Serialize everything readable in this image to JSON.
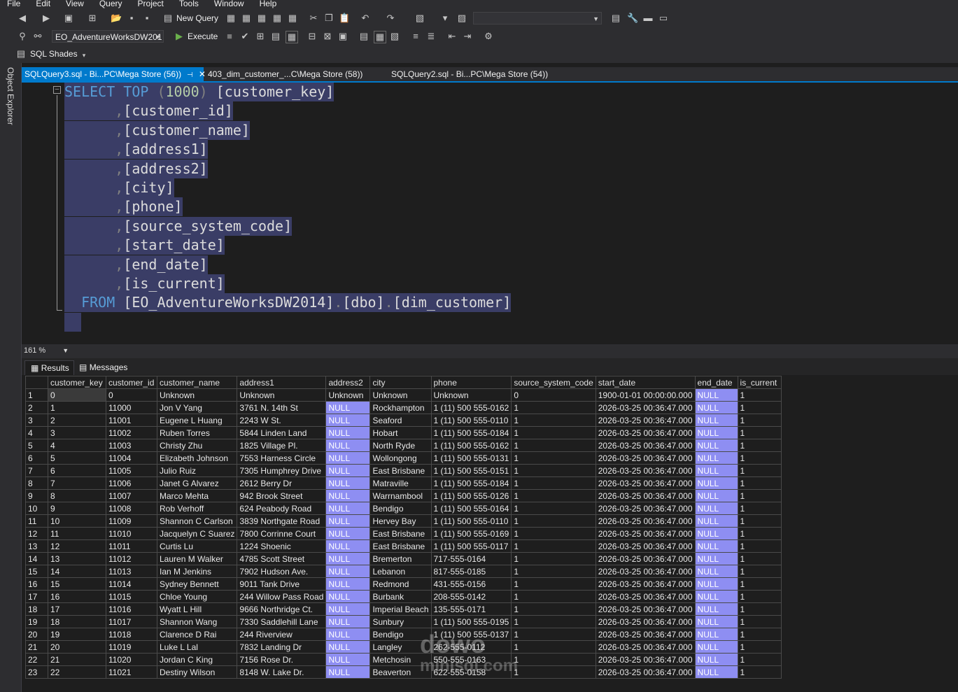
{
  "menu": [
    "File",
    "Edit",
    "View",
    "Query",
    "Project",
    "Tools",
    "Window",
    "Help"
  ],
  "toolbar": {
    "new_query_label": "New Query",
    "database": "EO_AdventureWorksDW201",
    "execute_label": "Execute",
    "sql_shades_label": "SQL Shades"
  },
  "sidebar": {
    "object_explorer": "Object Explorer"
  },
  "tabs": [
    {
      "label": "SQLQuery3.sql - Bi...PC\\Mega Store (56))"
    },
    {
      "label": "403_dim_customer_...C\\Mega Store (58))"
    },
    {
      "label": "SQLQuery2.sql - Bi...PC\\Mega Store (54))"
    }
  ],
  "editor": {
    "zoom": "161 %",
    "lines": [
      {
        "kw": "SELECT TOP ",
        "gr": "(",
        "num": "1000",
        "gr2": ")",
        "txt": " [customer_key]"
      },
      {
        "pre": "      ",
        "gr": ",",
        "txt": "[customer_id]"
      },
      {
        "pre": "      ",
        "gr": ",",
        "txt": "[customer_name]"
      },
      {
        "pre": "      ",
        "gr": ",",
        "txt": "[address1]"
      },
      {
        "pre": "      ",
        "gr": ",",
        "txt": "[address2]"
      },
      {
        "pre": "      ",
        "gr": ",",
        "txt": "[city]"
      },
      {
        "pre": "      ",
        "gr": ",",
        "txt": "[phone]"
      },
      {
        "pre": "      ",
        "gr": ",",
        "txt": "[source_system_code]"
      },
      {
        "pre": "      ",
        "gr": ",",
        "txt": "[start_date]"
      },
      {
        "pre": "      ",
        "gr": ",",
        "txt": "[end_date]"
      },
      {
        "pre": "      ",
        "gr": ",",
        "txt": "[is_current]"
      },
      {
        "pre": "  ",
        "kw": "FROM ",
        "txt": "[EO_AdventureWorksDW2014]",
        "gr": ".",
        "txt2": "[dbo]",
        "gr2": ".",
        "txt3": "[dim_customer]"
      }
    ]
  },
  "results_tabs": {
    "results": "Results",
    "messages": "Messages"
  },
  "grid": {
    "columns": [
      "customer_key",
      "customer_id",
      "customer_name",
      "address1",
      "address2",
      "city",
      "phone",
      "source_system_code",
      "start_date",
      "end_date",
      "is_current"
    ],
    "rows": [
      [
        "1",
        "0",
        "0",
        "Unknown",
        "Unknown",
        "Unknown",
        "Unknown",
        "Unknown",
        "0",
        "1900-01-01 00:00:00.000",
        "NULL",
        "1"
      ],
      [
        "2",
        "1",
        "11000",
        "Jon V Yang",
        "3761 N. 14th St",
        "NULL",
        "Rockhampton",
        "1 (11) 500 555-0162",
        "1",
        "2026-03-25 00:36:47.000",
        "NULL",
        "1"
      ],
      [
        "3",
        "2",
        "11001",
        "Eugene L Huang",
        "2243 W St.",
        "NULL",
        "Seaford",
        "1 (11) 500 555-0110",
        "1",
        "2026-03-25 00:36:47.000",
        "NULL",
        "1"
      ],
      [
        "4",
        "3",
        "11002",
        "Ruben  Torres",
        "5844 Linden Land",
        "NULL",
        "Hobart",
        "1 (11) 500 555-0184",
        "1",
        "2026-03-25 00:36:47.000",
        "NULL",
        "1"
      ],
      [
        "5",
        "4",
        "11003",
        "Christy  Zhu",
        "1825 Village Pl.",
        "NULL",
        "North Ryde",
        "1 (11) 500 555-0162",
        "1",
        "2026-03-25 00:36:47.000",
        "NULL",
        "1"
      ],
      [
        "6",
        "5",
        "11004",
        "Elizabeth  Johnson",
        "7553 Harness Circle",
        "NULL",
        "Wollongong",
        "1 (11) 500 555-0131",
        "1",
        "2026-03-25 00:36:47.000",
        "NULL",
        "1"
      ],
      [
        "7",
        "6",
        "11005",
        "Julio  Ruiz",
        "7305 Humphrey Drive",
        "NULL",
        "East Brisbane",
        "1 (11) 500 555-0151",
        "1",
        "2026-03-25 00:36:47.000",
        "NULL",
        "1"
      ],
      [
        "8",
        "7",
        "11006",
        "Janet G Alvarez",
        "2612 Berry Dr",
        "NULL",
        "Matraville",
        "1 (11) 500 555-0184",
        "1",
        "2026-03-25 00:36:47.000",
        "NULL",
        "1"
      ],
      [
        "9",
        "8",
        "11007",
        "Marco  Mehta",
        "942 Brook Street",
        "NULL",
        "Warrnambool",
        "1 (11) 500 555-0126",
        "1",
        "2026-03-25 00:36:47.000",
        "NULL",
        "1"
      ],
      [
        "10",
        "9",
        "11008",
        "Rob  Verhoff",
        "624 Peabody Road",
        "NULL",
        "Bendigo",
        "1 (11) 500 555-0164",
        "1",
        "2026-03-25 00:36:47.000",
        "NULL",
        "1"
      ],
      [
        "11",
        "10",
        "11009",
        "Shannon C Carlson",
        "3839 Northgate Road",
        "NULL",
        "Hervey Bay",
        "1 (11) 500 555-0110",
        "1",
        "2026-03-25 00:36:47.000",
        "NULL",
        "1"
      ],
      [
        "12",
        "11",
        "11010",
        "Jacquelyn C Suarez",
        "7800 Corrinne Court",
        "NULL",
        "East Brisbane",
        "1 (11) 500 555-0169",
        "1",
        "2026-03-25 00:36:47.000",
        "NULL",
        "1"
      ],
      [
        "13",
        "12",
        "11011",
        "Curtis  Lu",
        "1224 Shoenic",
        "NULL",
        "East Brisbane",
        "1 (11) 500 555-0117",
        "1",
        "2026-03-25 00:36:47.000",
        "NULL",
        "1"
      ],
      [
        "14",
        "13",
        "11012",
        "Lauren M Walker",
        "4785 Scott Street",
        "NULL",
        "Bremerton",
        "717-555-0164",
        "1",
        "2026-03-25 00:36:47.000",
        "NULL",
        "1"
      ],
      [
        "15",
        "14",
        "11013",
        "Ian M Jenkins",
        "7902 Hudson Ave.",
        "NULL",
        "Lebanon",
        "817-555-0185",
        "1",
        "2026-03-25 00:36:47.000",
        "NULL",
        "1"
      ],
      [
        "16",
        "15",
        "11014",
        "Sydney  Bennett",
        "9011 Tank Drive",
        "NULL",
        "Redmond",
        "431-555-0156",
        "1",
        "2026-03-25 00:36:47.000",
        "NULL",
        "1"
      ],
      [
        "17",
        "16",
        "11015",
        "Chloe  Young",
        "244 Willow Pass Road",
        "NULL",
        "Burbank",
        "208-555-0142",
        "1",
        "2026-03-25 00:36:47.000",
        "NULL",
        "1"
      ],
      [
        "18",
        "17",
        "11016",
        "Wyatt L Hill",
        "9666 Northridge Ct.",
        "NULL",
        "Imperial Beach",
        "135-555-0171",
        "1",
        "2026-03-25 00:36:47.000",
        "NULL",
        "1"
      ],
      [
        "19",
        "18",
        "11017",
        "Shannon  Wang",
        "7330 Saddlehill Lane",
        "NULL",
        "Sunbury",
        "1 (11) 500 555-0195",
        "1",
        "2026-03-25 00:36:47.000",
        "NULL",
        "1"
      ],
      [
        "20",
        "19",
        "11018",
        "Clarence D Rai",
        "244 Riverview",
        "NULL",
        "Bendigo",
        "1 (11) 500 555-0137",
        "1",
        "2026-03-25 00:36:47.000",
        "NULL",
        "1"
      ],
      [
        "21",
        "20",
        "11019",
        "Luke L Lal",
        "7832 Landing Dr",
        "NULL",
        "Langley",
        "262-555-0112",
        "1",
        "2026-03-25 00:36:47.000",
        "NULL",
        "1"
      ],
      [
        "22",
        "21",
        "11020",
        "Jordan C King",
        "7156 Rose Dr.",
        "NULL",
        "Metchosin",
        "550-555-0163",
        "1",
        "2026-03-25 00:36:47.000",
        "NULL",
        "1"
      ],
      [
        "23",
        "22",
        "11021",
        "Destiny  Wilson",
        "8148 W. Lake Dr.",
        "NULL",
        "Beaverton",
        "622-555-0158",
        "1",
        "2026-03-25 00:36:47.000",
        "NULL",
        "1"
      ]
    ]
  },
  "watermark": {
    "line1": "dowo",
    "line2": "minisql.com"
  }
}
